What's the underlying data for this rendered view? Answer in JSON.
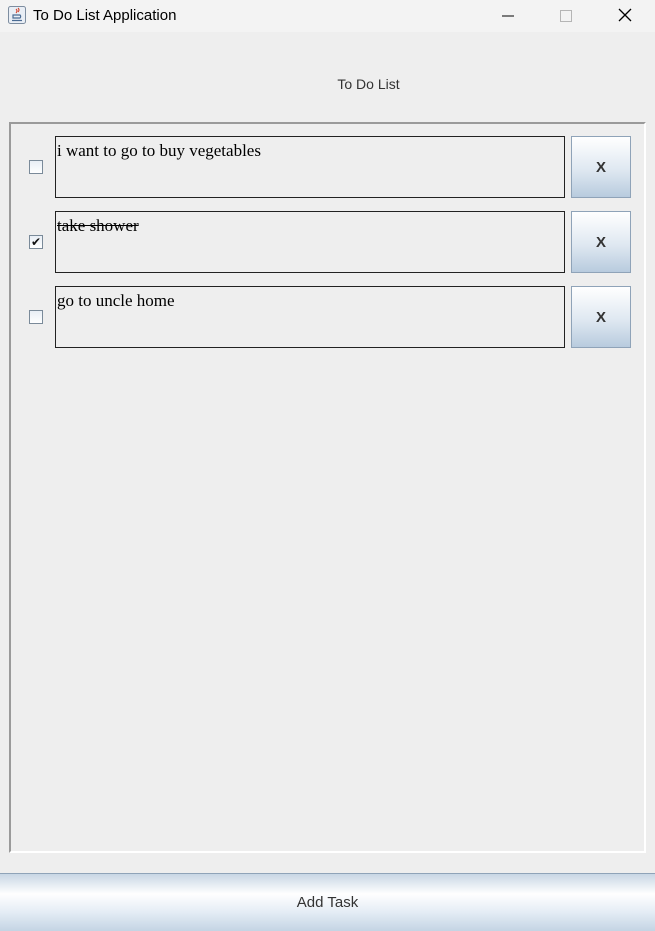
{
  "window": {
    "title": "To Do List Application",
    "icons": {
      "app": "java-app-icon",
      "minimize": "minimize-icon",
      "maximize": "maximize-icon",
      "close": "close-icon"
    }
  },
  "header": {
    "title": "To Do List"
  },
  "tasks": [
    {
      "text": "i want to go to buy vegetables",
      "checked": false,
      "delete_label": "X"
    },
    {
      "text": "take shower",
      "checked": true,
      "delete_label": "X"
    },
    {
      "text": "go to uncle home",
      "checked": false,
      "delete_label": "X"
    }
  ],
  "checkmark_glyph": "✔",
  "footer": {
    "add_label": "Add Task"
  },
  "colors": {
    "background": "#eeeeee",
    "button_gradient_top": "#ffffff",
    "button_gradient_bottom": "#b8cbde",
    "button_border": "#8fa3b8"
  }
}
